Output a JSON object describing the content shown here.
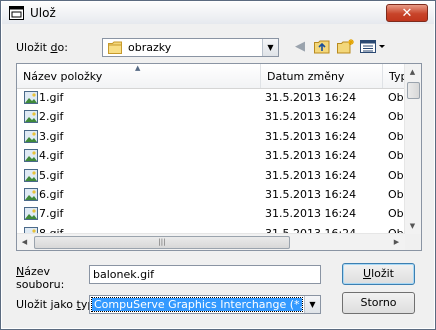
{
  "window": {
    "title": "Ulož",
    "close_label": "✕"
  },
  "location": {
    "label_prefix": "Uložit ",
    "label_underlined": "d",
    "label_suffix": "o:",
    "value": "obrazky"
  },
  "toolbar": {
    "back_icon": "◀",
    "up_icon": "folder-up",
    "new_folder_icon": "new-folder",
    "view_menu_icon": "view-menu"
  },
  "file_list": {
    "columns": [
      "Název položky",
      "Datum změny",
      "Typ"
    ],
    "rows": [
      {
        "name": "1.gif",
        "date": "31.5.2013 16:24",
        "type": "Obr"
      },
      {
        "name": "2.gif",
        "date": "31.5.2013 16:24",
        "type": "Obr"
      },
      {
        "name": "3.gif",
        "date": "31.5.2013 16:24",
        "type": "Obr"
      },
      {
        "name": "4.gif",
        "date": "31.5.2013 16:24",
        "type": "Obr"
      },
      {
        "name": "5.gif",
        "date": "31.5.2013 16:24",
        "type": "Obr"
      },
      {
        "name": "6.gif",
        "date": "31.5.2013 16:24",
        "type": "Obr"
      },
      {
        "name": "7.gif",
        "date": "31.5.2013 16:24",
        "type": "Obr"
      },
      {
        "name": "8.gif",
        "date": "31.5.2013 16:24",
        "type": "Obr"
      }
    ]
  },
  "filename": {
    "label_line1_underlined": "N",
    "label_line1_rest": "ázev",
    "label_line2": "souboru:",
    "value": "balonek.gif"
  },
  "filetype": {
    "label_prefix": "Uložit jako ",
    "label_underlined": "t",
    "label_suffix": "yp:",
    "value": "CompuServe Graphics Interchange (*.gif)"
  },
  "buttons": {
    "save_underlined": "U",
    "save_rest": "ložit",
    "cancel": "Storno"
  },
  "colors": {
    "selection": "#3399ff",
    "close": "#c8442a"
  }
}
